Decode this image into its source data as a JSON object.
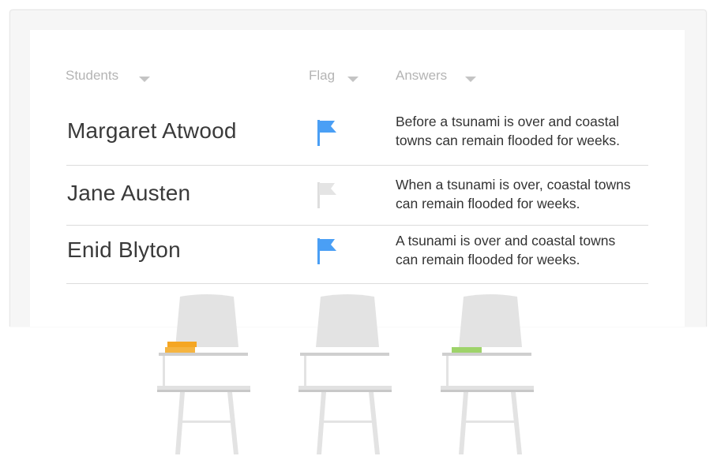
{
  "table": {
    "headers": {
      "students": "Students",
      "flag": "Flag",
      "answers": "Answers"
    },
    "rows": [
      {
        "name": "Margaret Atwood",
        "flagged": true,
        "answer_line1": "Before a tsunami is over and coastal",
        "answer_line2": "towns can remain flooded for weeks."
      },
      {
        "name": "Jane Austen",
        "flagged": false,
        "answer_line1": "When a tsunami is over, coastal towns",
        "answer_line2": "can remain flooded for weeks."
      },
      {
        "name": "Enid Blyton",
        "flagged": true,
        "answer_line1": "A tsunami is over and coastal towns",
        "answer_line2": "can remain flooded for weeks."
      }
    ]
  },
  "colors": {
    "flag_active": "#4a9ff5",
    "flag_inactive": "#dedede",
    "chair_gray": "#e3e3e3",
    "book_orange": "#f5a623",
    "book_green": "#9ed36a"
  },
  "icons": {
    "sort": "chevron-down-icon",
    "flag": "flag-icon"
  }
}
